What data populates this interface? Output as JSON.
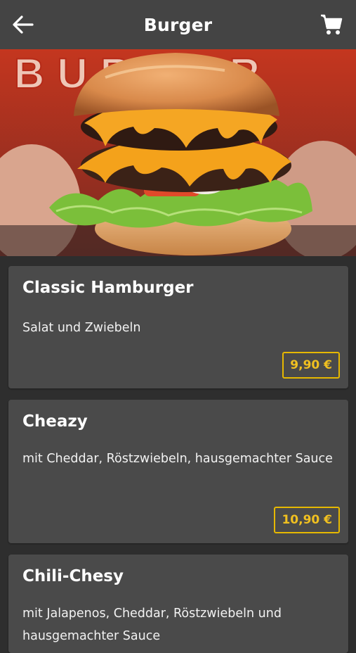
{
  "header": {
    "title": "Burger",
    "back_icon": "arrow-left-icon",
    "cart_icon": "cart-icon"
  },
  "hero": {
    "sign_text": "BURGER"
  },
  "items": [
    {
      "name": "Classic Hamburger",
      "description": "Salat und Zwiebeln",
      "price": "9,90 €"
    },
    {
      "name": "Cheazy",
      "description": "mit Cheddar, Röstzwiebeln, hausgemachter Sauce",
      "price": "10,90 €"
    },
    {
      "name": "Chili-Chesy",
      "description": "mit Jalapenos, Cheddar, Röstzwiebeln und hausgemachter Sauce",
      "price": ""
    }
  ],
  "colors": {
    "appbar": "#444444",
    "background": "#2e2e2e",
    "card": "#4a4a4a",
    "price_accent": "#e6b800"
  }
}
